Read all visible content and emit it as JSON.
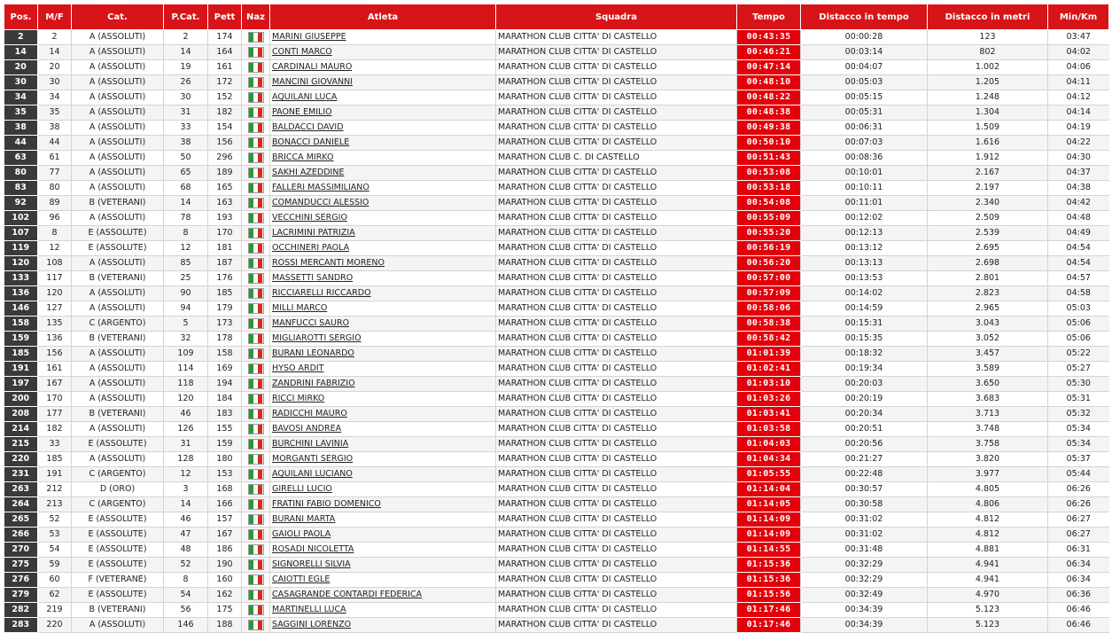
{
  "columns": {
    "pos": "Pos.",
    "mf": "M/F",
    "cat": "Cat.",
    "pcat": "P.Cat.",
    "pett": "Pett",
    "naz": "Naz",
    "athlete": "Atleta",
    "team": "Squadra",
    "time": "Tempo",
    "gap_time": "Distacco in tempo",
    "gap_meters": "Distacco in metri",
    "pace": "Min/Km"
  },
  "flag_icon": "italy-flag-icon",
  "colors": {
    "header": "#d71418",
    "time_cell": "#e3000b",
    "pos_cell": "#3a3a3a"
  },
  "rows": [
    [
      "2",
      "2",
      "A (ASSOLUTI)",
      "2",
      "174",
      "MARINI GIUSEPPE",
      "MARATHON CLUB CITTA' DI CASTELLO",
      "00:43:35",
      "00:00:28",
      "123",
      "03:47"
    ],
    [
      "14",
      "14",
      "A (ASSOLUTI)",
      "14",
      "164",
      "CONTI MARCO",
      "MARATHON CLUB CITTA' DI CASTELLO",
      "00:46:21",
      "00:03:14",
      "802",
      "04:02"
    ],
    [
      "20",
      "20",
      "A (ASSOLUTI)",
      "19",
      "161",
      "CARDINALI MAURO",
      "MARATHON CLUB CITTA' DI CASTELLO",
      "00:47:14",
      "00:04:07",
      "1.002",
      "04:06"
    ],
    [
      "30",
      "30",
      "A (ASSOLUTI)",
      "26",
      "172",
      "MANCINI GIOVANNI",
      "MARATHON CLUB CITTA' DI CASTELLO",
      "00:48:10",
      "00:05:03",
      "1.205",
      "04:11"
    ],
    [
      "34",
      "34",
      "A (ASSOLUTI)",
      "30",
      "152",
      "AQUILANI LUCA",
      "MARATHON CLUB CITTA' DI CASTELLO",
      "00:48:22",
      "00:05:15",
      "1.248",
      "04:12"
    ],
    [
      "35",
      "35",
      "A (ASSOLUTI)",
      "31",
      "182",
      "PAONE EMILIO",
      "MARATHON CLUB CITTA' DI CASTELLO",
      "00:48:38",
      "00:05:31",
      "1.304",
      "04:14"
    ],
    [
      "38",
      "38",
      "A (ASSOLUTI)",
      "33",
      "154",
      "BALDACCI DAVID",
      "MARATHON CLUB CITTA' DI CASTELLO",
      "00:49:38",
      "00:06:31",
      "1.509",
      "04:19"
    ],
    [
      "44",
      "44",
      "A (ASSOLUTI)",
      "38",
      "156",
      "BONACCI DANIELE",
      "MARATHON CLUB CITTA' DI CASTELLO",
      "00:50:10",
      "00:07:03",
      "1.616",
      "04:22"
    ],
    [
      "63",
      "61",
      "A (ASSOLUTI)",
      "50",
      "296",
      "BRICCA MIRKO",
      "MARATHON CLUB C. DI CASTELLO",
      "00:51:43",
      "00:08:36",
      "1.912",
      "04:30"
    ],
    [
      "80",
      "77",
      "A (ASSOLUTI)",
      "65",
      "189",
      "SAKHI AZEDDINE",
      "MARATHON CLUB CITTA' DI CASTELLO",
      "00:53:08",
      "00:10:01",
      "2.167",
      "04:37"
    ],
    [
      "83",
      "80",
      "A (ASSOLUTI)",
      "68",
      "165",
      "FALLERI MASSIMILIANO",
      "MARATHON CLUB CITTA' DI CASTELLO",
      "00:53:18",
      "00:10:11",
      "2.197",
      "04:38"
    ],
    [
      "92",
      "89",
      "B (VETERANI)",
      "14",
      "163",
      "COMANDUCCI ALESSIO",
      "MARATHON CLUB CITTA' DI CASTELLO",
      "00:54:08",
      "00:11:01",
      "2.340",
      "04:42"
    ],
    [
      "102",
      "96",
      "A (ASSOLUTI)",
      "78",
      "193",
      "VECCHINI SERGIO",
      "MARATHON CLUB CITTA' DI CASTELLO",
      "00:55:09",
      "00:12:02",
      "2.509",
      "04:48"
    ],
    [
      "107",
      "8",
      "E (ASSOLUTE)",
      "8",
      "170",
      "LACRIMINI PATRIZIA",
      "MARATHON CLUB CITTA' DI CASTELLO",
      "00:55:20",
      "00:12:13",
      "2.539",
      "04:49"
    ],
    [
      "119",
      "12",
      "E (ASSOLUTE)",
      "12",
      "181",
      "OCCHINERI PAOLA",
      "MARATHON CLUB CITTA' DI CASTELLO",
      "00:56:19",
      "00:13:12",
      "2.695",
      "04:54"
    ],
    [
      "120",
      "108",
      "A (ASSOLUTI)",
      "85",
      "187",
      "ROSSI MERCANTI MORENO",
      "MARATHON CLUB CITTA' DI CASTELLO",
      "00:56:20",
      "00:13:13",
      "2.698",
      "04:54"
    ],
    [
      "133",
      "117",
      "B (VETERANI)",
      "25",
      "176",
      "MASSETTI SANDRO",
      "MARATHON CLUB CITTA' DI CASTELLO",
      "00:57:00",
      "00:13:53",
      "2.801",
      "04:57"
    ],
    [
      "136",
      "120",
      "A (ASSOLUTI)",
      "90",
      "185",
      "RICCIARELLI RICCARDO",
      "MARATHON CLUB CITTA' DI CASTELLO",
      "00:57:09",
      "00:14:02",
      "2.823",
      "04:58"
    ],
    [
      "146",
      "127",
      "A (ASSOLUTI)",
      "94",
      "179",
      "MILLI MARCO",
      "MARATHON CLUB CITTA' DI CASTELLO",
      "00:58:06",
      "00:14:59",
      "2.965",
      "05:03"
    ],
    [
      "158",
      "135",
      "C (ARGENTO)",
      "5",
      "173",
      "MANFUCCI SAURO",
      "MARATHON CLUB CITTA' DI CASTELLO",
      "00:58:38",
      "00:15:31",
      "3.043",
      "05:06"
    ],
    [
      "159",
      "136",
      "B (VETERANI)",
      "32",
      "178",
      "MIGLIAROTTI SERGIO",
      "MARATHON CLUB CITTA' DI CASTELLO",
      "00:58:42",
      "00:15:35",
      "3.052",
      "05:06"
    ],
    [
      "185",
      "156",
      "A (ASSOLUTI)",
      "109",
      "158",
      "BURANI LEONARDO",
      "MARATHON CLUB CITTA' DI CASTELLO",
      "01:01:39",
      "00:18:32",
      "3.457",
      "05:22"
    ],
    [
      "191",
      "161",
      "A (ASSOLUTI)",
      "114",
      "169",
      "HYSO ARDIT",
      "MARATHON CLUB CITTA' DI CASTELLO",
      "01:02:41",
      "00:19:34",
      "3.589",
      "05:27"
    ],
    [
      "197",
      "167",
      "A (ASSOLUTI)",
      "118",
      "194",
      "ZANDRINI FABRIZIO",
      "MARATHON CLUB CITTA' DI CASTELLO",
      "01:03:10",
      "00:20:03",
      "3.650",
      "05:30"
    ],
    [
      "200",
      "170",
      "A (ASSOLUTI)",
      "120",
      "184",
      "RICCI MIRKO",
      "MARATHON CLUB CITTA' DI CASTELLO",
      "01:03:26",
      "00:20:19",
      "3.683",
      "05:31"
    ],
    [
      "208",
      "177",
      "B (VETERANI)",
      "46",
      "183",
      "RADICCHI MAURO",
      "MARATHON CLUB CITTA' DI CASTELLO",
      "01:03:41",
      "00:20:34",
      "3.713",
      "05:32"
    ],
    [
      "214",
      "182",
      "A (ASSOLUTI)",
      "126",
      "155",
      "BAVOSI ANDREA",
      "MARATHON CLUB CITTA' DI CASTELLO",
      "01:03:58",
      "00:20:51",
      "3.748",
      "05:34"
    ],
    [
      "215",
      "33",
      "E (ASSOLUTE)",
      "31",
      "159",
      "BURCHINI LAVINIA",
      "MARATHON CLUB CITTA' DI CASTELLO",
      "01:04:03",
      "00:20:56",
      "3.758",
      "05:34"
    ],
    [
      "220",
      "185",
      "A (ASSOLUTI)",
      "128",
      "180",
      "MORGANTI SERGIO",
      "MARATHON CLUB CITTA' DI CASTELLO",
      "01:04:34",
      "00:21:27",
      "3.820",
      "05:37"
    ],
    [
      "231",
      "191",
      "C (ARGENTO)",
      "12",
      "153",
      "AQUILANI LUCIANO",
      "MARATHON CLUB CITTA' DI CASTELLO",
      "01:05:55",
      "00:22:48",
      "3.977",
      "05:44"
    ],
    [
      "263",
      "212",
      "D (ORO)",
      "3",
      "168",
      "GIRELLI LUCIO",
      "MARATHON CLUB CITTA' DI CASTELLO",
      "01:14:04",
      "00:30:57",
      "4.805",
      "06:26"
    ],
    [
      "264",
      "213",
      "C (ARGENTO)",
      "14",
      "166",
      "FRATINI FABIO DOMENICO",
      "MARATHON CLUB CITTA' DI CASTELLO",
      "01:14:05",
      "00:30:58",
      "4.806",
      "06:26"
    ],
    [
      "265",
      "52",
      "E (ASSOLUTE)",
      "46",
      "157",
      "BURANI MARTA",
      "MARATHON CLUB CITTA' DI CASTELLO",
      "01:14:09",
      "00:31:02",
      "4.812",
      "06:27"
    ],
    [
      "266",
      "53",
      "E (ASSOLUTE)",
      "47",
      "167",
      "GAIOLI PAOLA",
      "MARATHON CLUB CITTA' DI CASTELLO",
      "01:14:09",
      "00:31:02",
      "4.812",
      "06:27"
    ],
    [
      "270",
      "54",
      "E (ASSOLUTE)",
      "48",
      "186",
      "ROSADI NICOLETTA",
      "MARATHON CLUB CITTA' DI CASTELLO",
      "01:14:55",
      "00:31:48",
      "4.881",
      "06:31"
    ],
    [
      "275",
      "59",
      "E (ASSOLUTE)",
      "52",
      "190",
      "SIGNORELLI SILVIA",
      "MARATHON CLUB CITTA' DI CASTELLO",
      "01:15:36",
      "00:32:29",
      "4.941",
      "06:34"
    ],
    [
      "276",
      "60",
      "F (VETERANE)",
      "8",
      "160",
      "CAIOTTI EGLE",
      "MARATHON CLUB CITTA' DI CASTELLO",
      "01:15:36",
      "00:32:29",
      "4.941",
      "06:34"
    ],
    [
      "279",
      "62",
      "E (ASSOLUTE)",
      "54",
      "162",
      "CASAGRANDE CONTARDI FEDERICA",
      "MARATHON CLUB CITTA' DI CASTELLO",
      "01:15:56",
      "00:32:49",
      "4.970",
      "06:36"
    ],
    [
      "282",
      "219",
      "B (VETERANI)",
      "56",
      "175",
      "MARTINELLI LUCA",
      "MARATHON CLUB CITTA' DI CASTELLO",
      "01:17:46",
      "00:34:39",
      "5.123",
      "06:46"
    ],
    [
      "283",
      "220",
      "A (ASSOLUTI)",
      "146",
      "188",
      "SAGGINI LORENZO",
      "MARATHON CLUB CITTA' DI CASTELLO",
      "01:17:46",
      "00:34:39",
      "5.123",
      "06:46"
    ]
  ]
}
